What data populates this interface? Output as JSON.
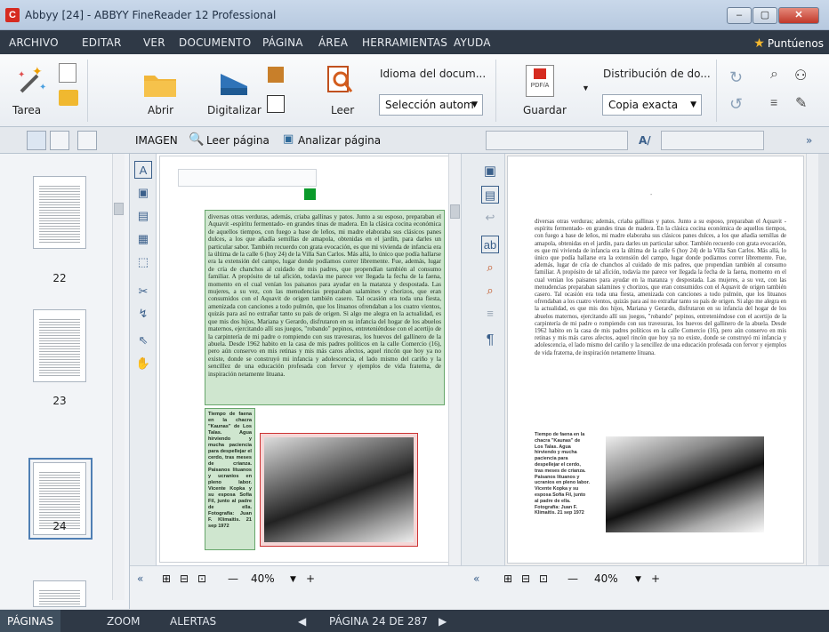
{
  "window": {
    "title": "Abbyy [24] - ABBYY FineReader 12 Professional",
    "logo": "C",
    "controls": {
      "minimize": "–",
      "maximize": "▢",
      "close": "✕"
    }
  },
  "menu": {
    "items": [
      "ARCHIVO",
      "EDITAR",
      "VER",
      "DOCUMENTO",
      "PÁGINA",
      "ÁREA",
      "HERRAMIENTAS",
      "AYUDA"
    ],
    "points_label": "Puntúenos"
  },
  "ribbon": {
    "task_label": "Tarea",
    "open_label": "Abrir",
    "scan_label": "Digitalizar",
    "read_label": "Leer",
    "language_title": "Idioma del docum...",
    "language_value": "Selección autom",
    "save_label": "Guardar",
    "layout_title": "Distribución de do...",
    "layout_value": "Copia exacta",
    "pdf_badge": "PDF/A"
  },
  "toolbar2": {
    "image_label": "IMAGEN",
    "read_page_label": "Leer página",
    "analyze_page_label": "Analizar página"
  },
  "thumbnails": [
    {
      "number": "22"
    },
    {
      "number": "23"
    },
    {
      "number": "24",
      "selected": true
    }
  ],
  "image_text": {
    "main": "diversas otras verduras, además, criaba gallinas y patos. Junto a su esposo, preparaban el Aquavit -espíritu fermentado- en grandes tinas de madera. En la clásica cocina económica de aquellos tiempos, con fuego a base de leños, mi madre elaboraba sus clásicos panes dulces, a los que añadía semillas de amapola, obtenidas en el jardín, para darles un particular sabor. También recuerdo con grata evocación, es que mi vivienda de infancia era la última de la calle 6 (hoy 24) de la Villa San Carlos. Más allá, lo único que podía hallarse era la extensión del campo, lugar donde podíamos correr libremente. Fue, además, lugar de cría de chanchos al cuidado de mis padres, que propendían también al consumo familiar. A propósito de tal afición, todavía me parece ver llegada la fecha de la faena, momento en el cual venían los paisanos para ayudar en la matanza y despostada. Las mujeres, a su vez, con las menudencias preparaban salamines y chorizos, que eran consumidos con el Aquavit de origen también casero. Tal ocasión era toda una fiesta, amenizada con canciones a todo pulmón, que los lituanos ofrendaban a los cuatro vientos, quizás para así no extrañar tanto su país de origen. Si algo me alegra en la actualidad, es que mis dos hijos, Mariana y Gerardo, disfrutaron en su infancia del hogar de los abuelos maternos, ejercitando allí sus juegos, \"robando\" pepinos, entreteniéndose con el acertijo de la carpintería de mi padre o rompiendo con sus travesuras, los huevos del gallinero de la abuela. Desde 1962 habito en la casa de mis padres políticos en la calle Comercio (16), pero aún conservo en mis retinas y mis más caros afectos, aquel rincón que hoy ya no existe, donde se construyó mi infancia y adolescencia, el lado mismo del cariño y la sencillez de una educación profesada con fervor y ejemplos de vida fraterna, de inspiración netamente lituana.",
    "caption": "Tiempo de faena en la chacra \"Kaunas\" de Los Talas. Agua hirviendo y mucha paciencia para despellejar el cerdo, tras meses de crianza. Paisanos lituanos y ucranios en pleno labor. Vicente Kopka y su esposa Sofía Fil, junto al padre de ella. Fotografía: Juan F. Klimaitis. 21 sep 1972"
  },
  "text_view": {
    "heading": "-",
    "main": "diversas otras verduras; además, criaba gallinas y patos. Junto a su esposo, preparaban el Aquavit -espíritu fermentado- en grandes tinas de madera. En la clásica cocina económica de aquellos tiempos, con fuego a base de leños, mi madre elaboraba sus clásicos panes dulces, a los que añadía semillas de amapola, obtenidas en el jardín, para darles un particular sabor. También recuerdo con grata evocación, es que mi vivienda de infancia era la última de la calle 6 (hoy 24) de la Villa San Carlos. Más allá, lo único que podía hallarse era la extensión del campo, lugar donde podíamos correr libremente. Fue, además, lugar de cría de chanchos al cuidado de mis padres, que propendían también al consumo familiar. A propósito de tal afición, todavía me parece ver llegada la fecha de la faena, momento en el cual venían los paisanos para ayudar en la matanza y despostada. Las mujeres, a su vez, con las menudencias preparaban salamines y chorizos, que eran consumidos con el Aquavit de origen también casero. Tal ocasión era toda una fiesta, amenizada con canciones a todo pulmón, que los lituanos ofrendaban a los cuatro vientos, quizás para así no extrañar tanto su país de origen. Si algo me alegra en la actualidad, es que mis dos hijos, Mariana y Gerardo, disfrutaron en su infancia del hogar de los abuelos maternos, ejercitando allí sus juegos, \"robando\" pepinos, entreteniéndose con el acertijo de la carpintería de mi padre o rompiendo con sus travesuras, los huevos del gallinero de la abuela. Desde 1962 habito en la casa de mis padres políticos en la calle Comercio (16), pero aún conservo en mis retinas y mis más caros afectos, aquel rincón que hoy ya no existe, donde se construyó mi infancia y adolescencia, el lado mismo del cariño y la sencillez de una educación profesada con fervor y ejemplos de vida fraterna, de inspiración netamente lituana.",
    "caption": "Tiempo de faena en la chacra \"Kaunas\" de Los Talas. Agua hirviendo y mucha paciencia para despellejar el cerdo, tras meses de crianza. Paisanos lituanos y ucranios en pleno labor. Vicente Kopka y su esposa Sofía Fil, junto al padre de ella. Fotografía: Juan F. Klimaitis. 21 sep 1972"
  },
  "zoom": {
    "image_value": "40%",
    "text_value": "40%",
    "minus": "—",
    "plus": "+"
  },
  "status": {
    "tab_pages": "PÁGINAS",
    "tab_zoom": "ZOOM",
    "tab_alerts": "ALERTAS",
    "page_indicator": "PÁGINA 24 DE 287",
    "prev": "◀",
    "next": "▶"
  },
  "colors": {
    "menubar_bg": "#2f3946",
    "text_area": "#cfe6cf",
    "picture_area": "#f5d7d7",
    "picture_border": "#cc3333",
    "selected_thumb": "#4f7fb4"
  }
}
